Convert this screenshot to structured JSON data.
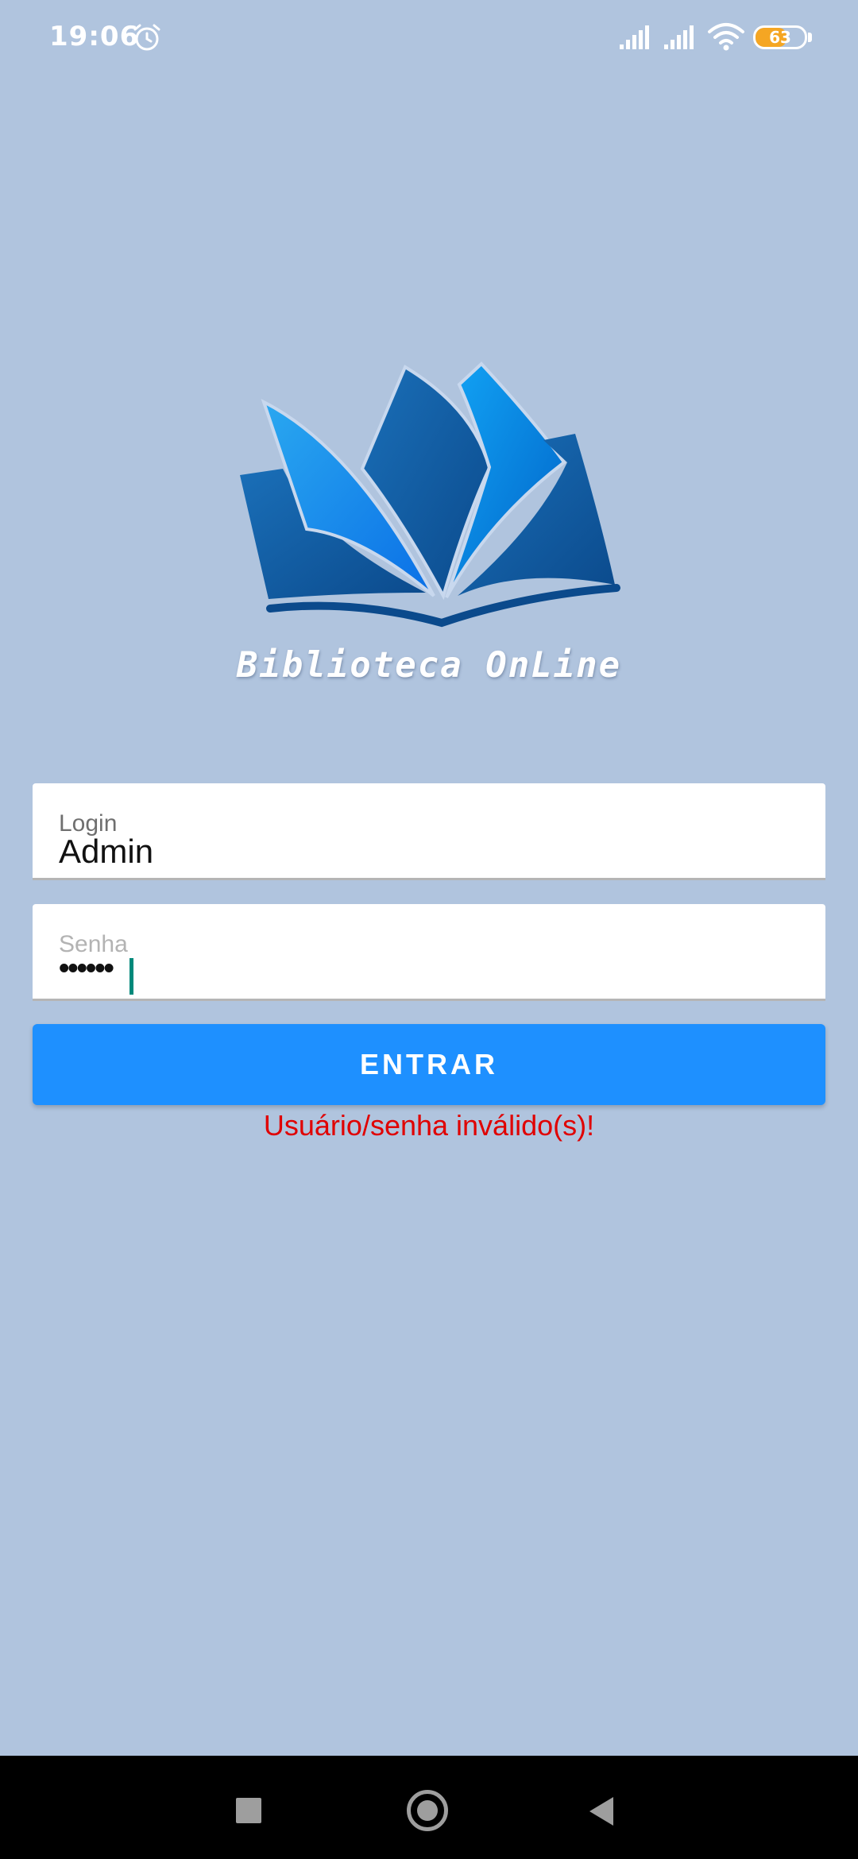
{
  "status_bar": {
    "time": "19:06",
    "battery_level": "63",
    "icons": [
      "alarm-icon",
      "signal-icon",
      "signal-icon",
      "wifi-icon",
      "battery-icon"
    ]
  },
  "logo": {
    "icon": "open-book-icon",
    "text": "Biblioteca OnLine"
  },
  "login_form": {
    "login": {
      "label": "Login",
      "value": "Admin"
    },
    "senha": {
      "label": "Senha",
      "value": "••••••"
    },
    "submit_label": "ENTRAR",
    "error_message": "Usuário/senha inválido(s)!"
  },
  "colors": {
    "background": "#b0c4de",
    "button": "#1e90ff",
    "error": "#e00000",
    "cursor": "#00897b",
    "battery": "#f5a623"
  },
  "nav_bar": {
    "buttons": [
      "recents-icon",
      "home-icon",
      "back-icon"
    ]
  }
}
